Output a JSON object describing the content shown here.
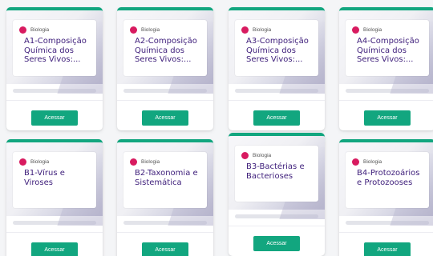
{
  "cards": [
    {
      "subject": "Biologia",
      "title": "A1-Composição Química dos Seres Vivos:...",
      "button": "Acessar",
      "progress": 0
    },
    {
      "subject": "Biologia",
      "title": "A2-Composição Química dos Seres Vivos:...",
      "button": "Acessar",
      "progress": 0
    },
    {
      "subject": "Biologia",
      "title": "A3-Composição Química dos Seres Vivos:...",
      "button": "Acessar",
      "progress": 0
    },
    {
      "subject": "Biologia",
      "title": "A4-Composição Química dos Seres Vivos:...",
      "button": "Acessar",
      "progress": 0
    },
    {
      "subject": "Biologia",
      "title": "B1-Vírus e Viroses",
      "button": "Acessar",
      "progress": 0
    },
    {
      "subject": "Biologia",
      "title": "B2-Taxonomia e Sistemática",
      "button": "Acessar",
      "progress": 0
    },
    {
      "subject": "Biologia",
      "title": "B3-Bactérias e Bacterioses",
      "button": "Acessar",
      "progress": 0
    },
    {
      "subject": "Biologia",
      "title": "B4-Protozoários e Protozooses",
      "button": "Acessar",
      "progress": 0
    }
  ],
  "colors": {
    "accent": "#12a67f",
    "subject_dot": "#d81b60",
    "title": "#3d1d7a"
  }
}
